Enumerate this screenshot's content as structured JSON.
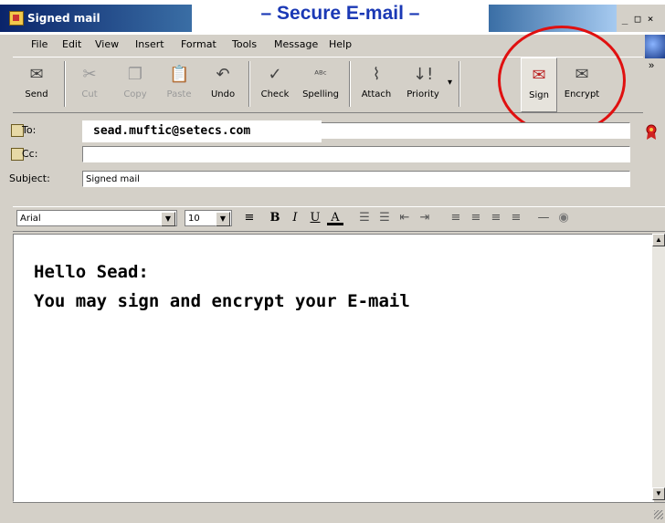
{
  "window": {
    "title": "Signed mail"
  },
  "banner": {
    "text": "– Secure E-mail –"
  },
  "window_controls": {
    "minimize": "_",
    "maximize": "□",
    "close": "×"
  },
  "menu": [
    "File",
    "Edit",
    "View",
    "Insert",
    "Format",
    "Tools",
    "Message",
    "Help"
  ],
  "toolbar": {
    "buttons": [
      {
        "label": "Send",
        "icon": "send-icon",
        "glyph": "✉"
      },
      {
        "label": "Cut",
        "icon": "scissors-icon",
        "glyph": "✂"
      },
      {
        "label": "Copy",
        "icon": "copy-icon",
        "glyph": "❐"
      },
      {
        "label": "Paste",
        "icon": "paste-icon",
        "glyph": "📋"
      },
      {
        "label": "Undo",
        "icon": "undo-icon",
        "glyph": "↶"
      },
      {
        "label": "Check",
        "icon": "check-names-icon",
        "glyph": "✓"
      },
      {
        "label": "Spelling",
        "icon": "spelling-icon",
        "glyph": "ᴬᴮᶜ"
      },
      {
        "label": "Attach",
        "icon": "paperclip-icon",
        "glyph": "⌇"
      },
      {
        "label": "Priority",
        "icon": "priority-icon",
        "glyph": "↓!"
      },
      {
        "label": "Sign",
        "icon": "sign-icon",
        "glyph": "✉"
      },
      {
        "label": "Encrypt",
        "icon": "encrypt-icon",
        "glyph": "✉"
      }
    ],
    "more": "»"
  },
  "fields": {
    "to_label": "To:",
    "to_value": "sead.muftic@setecs.com",
    "cc_label": "Cc:",
    "cc_value": "",
    "subject_label": "Subject:",
    "subject_value": "Signed mail"
  },
  "format": {
    "font": "Arial",
    "size": "10",
    "buttons": [
      "B",
      "I",
      "U",
      "A"
    ]
  },
  "body": {
    "line1": "Hello Sead:",
    "line2": "You may sign and encrypt your E-mail"
  },
  "accent_colors": {
    "banner_text": "#1b39b5",
    "highlight_circle": "#e01010",
    "titlebar": "#0a246a"
  }
}
